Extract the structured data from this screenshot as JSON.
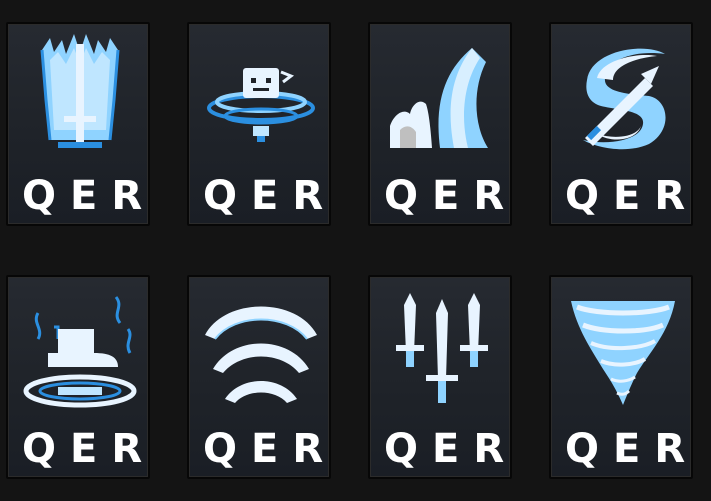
{
  "cards": [
    {
      "icon": "ice-spike-crown-icon",
      "keys": "QER"
    },
    {
      "icon": "ice-golem-whirlpool-icon",
      "keys": "QER"
    },
    {
      "icon": "frost-crescent-slash-icon",
      "keys": "QER"
    },
    {
      "icon": "ice-sword-swirl-icon",
      "keys": "QER"
    },
    {
      "icon": "frost-boot-ring-icon",
      "keys": "QER"
    },
    {
      "icon": "frost-wave-arcs-icon",
      "keys": "QER"
    },
    {
      "icon": "triple-ice-swords-icon",
      "keys": "QER"
    },
    {
      "icon": "ice-tornado-icon",
      "keys": "QER"
    }
  ],
  "colors": {
    "background": "#141414",
    "card": "#1f2329",
    "ice_light": "#e8f4ff",
    "ice_mid": "#8fd3ff",
    "ice_dark": "#2b8fe0"
  }
}
